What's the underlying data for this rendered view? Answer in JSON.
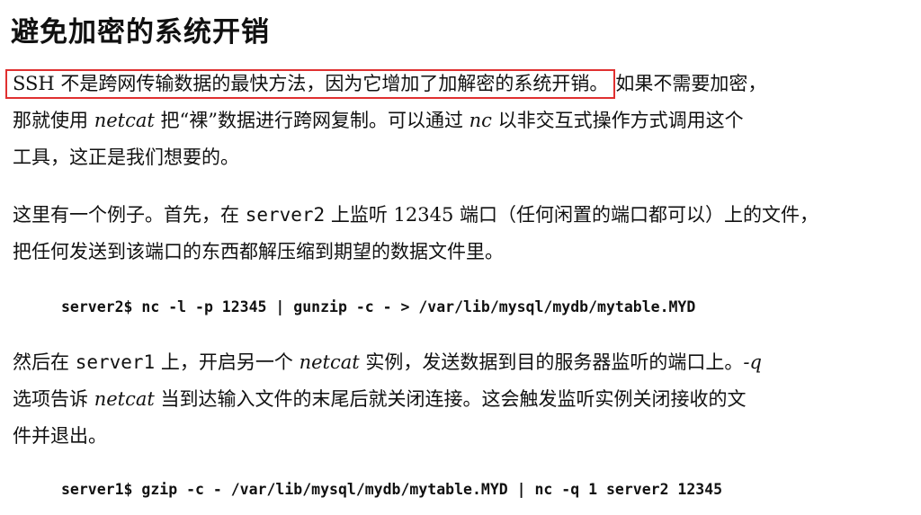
{
  "heading": "避免加密的系统开销",
  "paragraph1": {
    "highlighted": "SSH 不是跨网传输数据的最快方法，因为它增加了加解密的系统开销。",
    "line1_rest": "如果不需要加密，",
    "line2_a": "那就使用 ",
    "line2_netcat": "netcat",
    "line2_b": " 把“裸”数据进行跨网复制。可以通过 ",
    "line2_nc": "nc",
    "line2_c": " 以非交互式操作方式调用这个",
    "line3": "工具，这正是我们想要的。"
  },
  "paragraph2": {
    "line1_a": "这里有一个例子。首先，在 ",
    "line1_server2": "server2",
    "line1_b": " 上监听 12345 端口（任何闲置的端口都可以）上的文件，",
    "line2": "把任何发送到该端口的东西都解压缩到期望的数据文件里。"
  },
  "code1": "server2$ nc -l -p 12345 | gunzip -c - > /var/lib/mysql/mydb/mytable.MYD",
  "paragraph3": {
    "line1_a": "然后在 ",
    "line1_server1": "server1",
    "line1_b": " 上，开启另一个 ",
    "line1_netcat": "netcat",
    "line1_c": " 实例，发送数据到目的服务器监听的端口上。",
    "line1_opt": "-q",
    "line2_a": "选项告诉 ",
    "line2_netcat": "netcat",
    "line2_b": " 当到达输入文件的末尾后就关闭连接。这会触发监听实例关闭接收的文",
    "line3": "件并退出。"
  },
  "code2": "server1$ gzip -c - /var/lib/mysql/mydb/mytable.MYD | nc -q 1 server2 12345",
  "colors": {
    "highlight_border": "#e03030",
    "text": "#111111",
    "background": "#ffffff"
  }
}
